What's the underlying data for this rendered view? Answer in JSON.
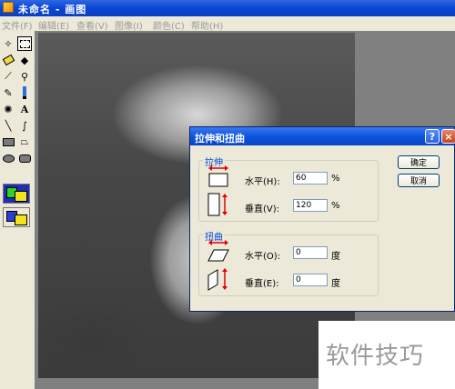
{
  "window": {
    "title": "未命名 - 画图"
  },
  "menu": {
    "items": [
      "文件(F)",
      "编辑(E)",
      "查看(V)",
      "图像(I)",
      "颜色(C)",
      "帮助(H)"
    ]
  },
  "toolbox": {
    "tools": [
      "free-select",
      "rect-select",
      "eraser",
      "fill",
      "color-picker",
      "magnifier",
      "pencil",
      "brush",
      "airbrush",
      "text",
      "line",
      "curve",
      "rectangle",
      "polygon",
      "ellipse",
      "rounded-rect"
    ]
  },
  "dialog": {
    "title": "拉伸和扭曲",
    "help_label": "?",
    "close_label": "×",
    "stretch": {
      "group_label": "拉伸",
      "horizontal_label": "水平(H):",
      "horizontal_value": "60",
      "vertical_label": "垂直(V):",
      "vertical_value": "120",
      "unit": "%"
    },
    "skew": {
      "group_label": "扭曲",
      "horizontal_label": "水平(O):",
      "horizontal_value": "0",
      "vertical_label": "垂直(E):",
      "vertical_value": "0",
      "unit": "度"
    },
    "ok_label": "确定",
    "cancel_label": "取消"
  },
  "watermark": {
    "text": "软件技巧"
  }
}
